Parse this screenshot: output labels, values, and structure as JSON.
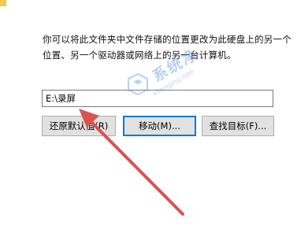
{
  "description": {
    "line1": "你可以将此文件夹中文件存储的位置更改为此硬盘上的另一个",
    "line2": "位置、另一个驱动器或网络上的另一台计算机。"
  },
  "location": {
    "value": "E:\\录屏"
  },
  "buttons": {
    "restore_default": "还原默认值(R)",
    "move": "移动(M)...",
    "find_target": "查找目标(F)..."
  },
  "watermark": {
    "text": "系统净",
    "url": "xitongjing.com"
  },
  "colors": {
    "arrow": "#d9534f",
    "focus_border": "#0078d7",
    "button_bg": "#e1e1e1",
    "watermark": "#3a7bd5"
  },
  "icons": {
    "watermark_logo": "watermark-logo-icon",
    "annotation_arrow": "red-arrow-icon"
  }
}
